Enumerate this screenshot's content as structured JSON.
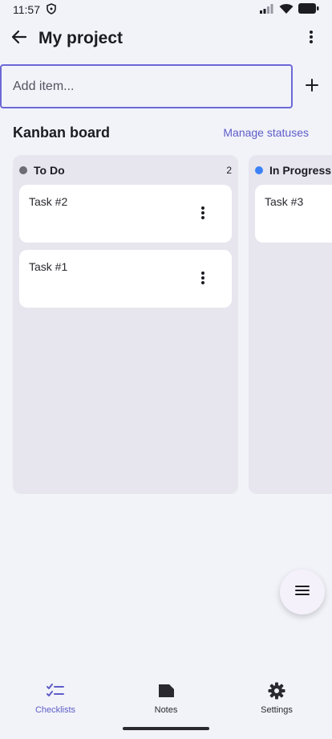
{
  "status_bar": {
    "time": "11:57",
    "icons": [
      "shield-icon",
      "signal-icon",
      "wifi-icon",
      "battery-icon"
    ]
  },
  "app_bar": {
    "title": "My project",
    "back_icon": "arrow-left-icon",
    "overflow_icon": "more-vert-icon"
  },
  "add_item": {
    "placeholder": "Add item...",
    "value": "",
    "add_icon": "plus-icon"
  },
  "board": {
    "title": "Kanban board",
    "manage_label": "Manage statuses",
    "columns": [
      {
        "title": "To Do",
        "count": "2",
        "dot_color": "#6d6b74",
        "cards": [
          {
            "title": "Task #2"
          },
          {
            "title": "Task #1"
          }
        ]
      },
      {
        "title": "In Progress",
        "count": "",
        "dot_color": "#3c82f6",
        "cards": [
          {
            "title": "Task #3"
          }
        ]
      }
    ]
  },
  "fab": {
    "icon": "menu-icon"
  },
  "bottom_nav": {
    "items": [
      {
        "label": "Checklists",
        "icon": "checklist-icon",
        "active": true
      },
      {
        "label": "Notes",
        "icon": "note-icon",
        "active": false
      },
      {
        "label": "Settings",
        "icon": "gear-icon",
        "active": false
      }
    ]
  },
  "colors": {
    "accent": "#5f5cc8",
    "background": "#f1f3f9",
    "column_bg": "#e7e6ef"
  }
}
